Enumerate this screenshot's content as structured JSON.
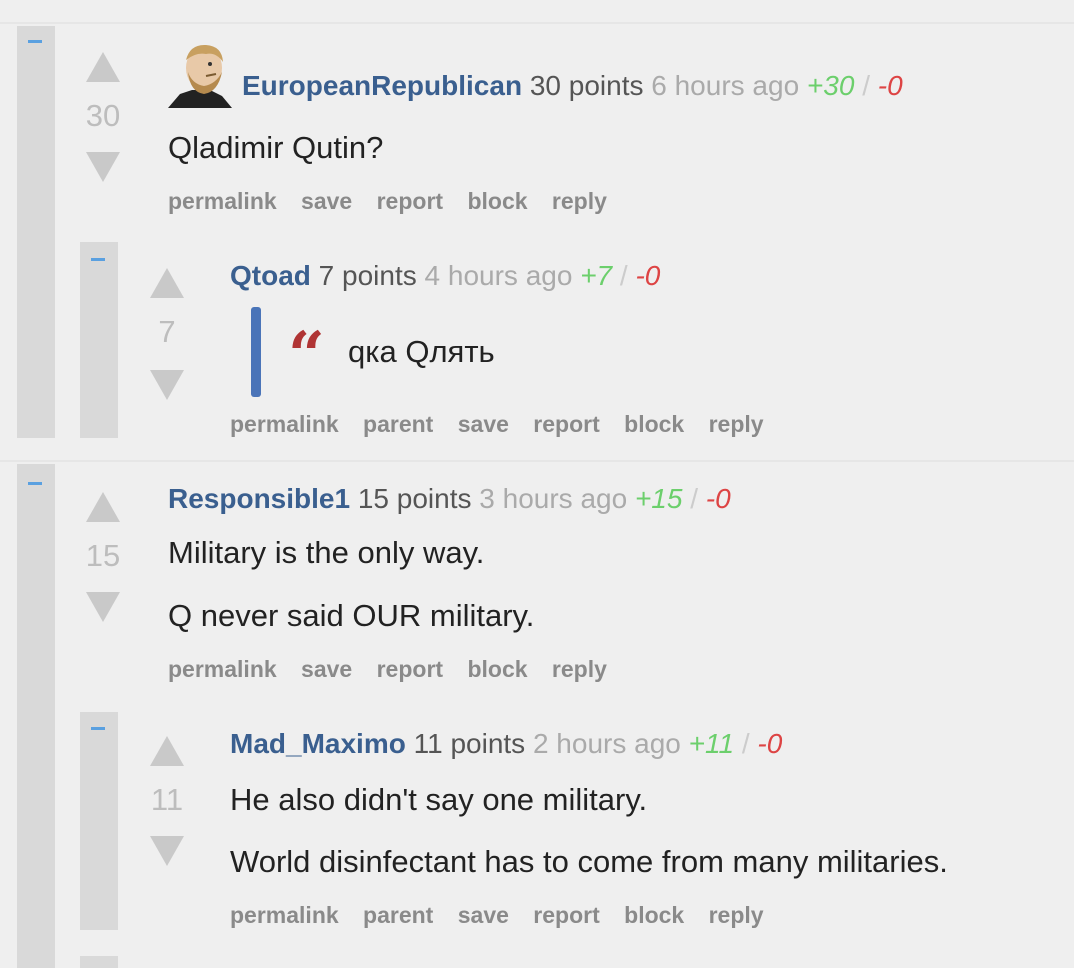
{
  "comments": [
    {
      "user": "EuropeanRepublican",
      "points": "30 points",
      "ago": "6 hours ago",
      "up": "+30",
      "slash": "/",
      "down": "-0",
      "score": "30",
      "lines": [
        "Qladimir Qutin?"
      ],
      "actions": [
        "permalink",
        "save",
        "report",
        "block",
        "reply"
      ],
      "avatar": "chad-avatar-icon"
    },
    {
      "user": "Qtoad",
      "points": "7 points",
      "ago": "4 hours ago",
      "up": "+7",
      "slash": "/",
      "down": "-0",
      "score": "7",
      "quote_mark": "“",
      "quote_text": "qка Qлять",
      "actions": [
        "permalink",
        "parent",
        "save",
        "report",
        "block",
        "reply"
      ]
    },
    {
      "user": "Responsible1",
      "points": "15 points",
      "ago": "3 hours ago",
      "up": "+15",
      "slash": "/",
      "down": "-0",
      "score": "15",
      "lines": [
        "Military is the only way.",
        "Q never said OUR military."
      ],
      "actions": [
        "permalink",
        "save",
        "report",
        "block",
        "reply"
      ]
    },
    {
      "user": "Mad_Maximo",
      "points": "11 points",
      "ago": "2 hours ago",
      "up": "+11",
      "slash": "/",
      "down": "-0",
      "score": "11",
      "lines": [
        "He also didn't say one military.",
        "World disinfectant has to come from many militaries."
      ],
      "actions": [
        "permalink",
        "parent",
        "save",
        "report",
        "block",
        "reply"
      ]
    }
  ],
  "colors": {
    "background": "#efefef",
    "thread_bar": "#d9d9d9",
    "username": "#3a5f8f",
    "upvotes": "#6ccf6c",
    "downvotes": "#dd4444",
    "collapse": "#5aa0e0",
    "quote_bar": "#4a74b8",
    "quote_mark": "#b03434"
  }
}
